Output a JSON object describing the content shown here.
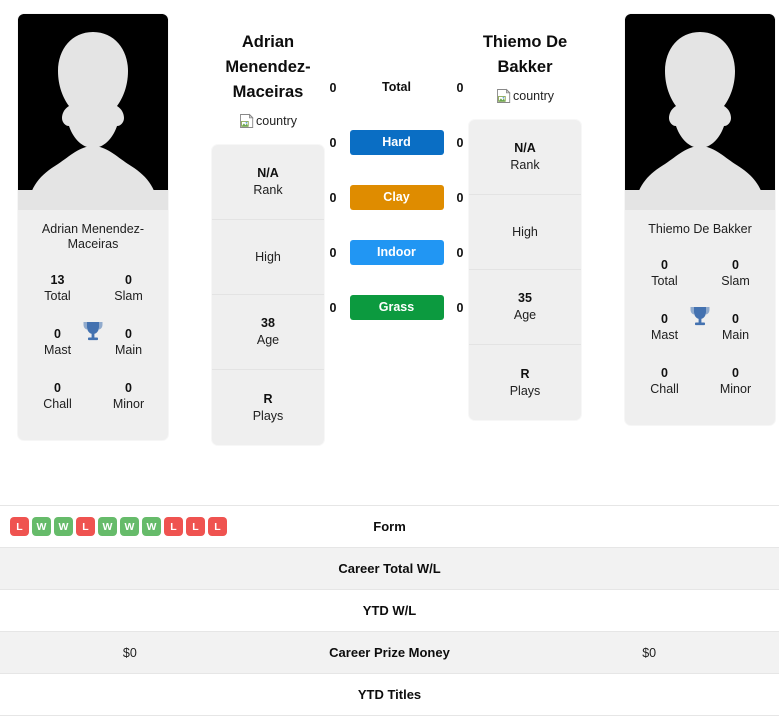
{
  "players": {
    "left": {
      "full_name": "Adrian Menendez-Maceiras",
      "card_name": "Adrian Menendez-Maceiras",
      "country_alt": "country",
      "titles": [
        {
          "value": "13",
          "label": "Total"
        },
        {
          "value": "0",
          "label": "Slam"
        },
        {
          "value": "0",
          "label": "Mast"
        },
        {
          "value": "0",
          "label": "Main"
        },
        {
          "value": "0",
          "label": "Chall"
        },
        {
          "value": "0",
          "label": "Minor"
        }
      ],
      "info": [
        {
          "value": "N/A",
          "label": "Rank"
        },
        {
          "value": "",
          "label": "High"
        },
        {
          "value": "38",
          "label": "Age"
        },
        {
          "value": "R",
          "label": "Plays"
        }
      ],
      "surface_counts": [
        "0",
        "0",
        "0",
        "0",
        "0"
      ],
      "form": [
        "L",
        "W",
        "W",
        "L",
        "W",
        "W",
        "W",
        "L",
        "L",
        "L"
      ],
      "career_total_wl": "",
      "ytd_wl": "",
      "career_prize_money": "$0",
      "ytd_titles": ""
    },
    "right": {
      "full_name": "Thiemo De Bakker",
      "card_name": "Thiemo De Bakker",
      "country_alt": "country",
      "titles": [
        {
          "value": "0",
          "label": "Total"
        },
        {
          "value": "0",
          "label": "Slam"
        },
        {
          "value": "0",
          "label": "Mast"
        },
        {
          "value": "0",
          "label": "Main"
        },
        {
          "value": "0",
          "label": "Chall"
        },
        {
          "value": "0",
          "label": "Minor"
        }
      ],
      "info": [
        {
          "value": "N/A",
          "label": "Rank"
        },
        {
          "value": "",
          "label": "High"
        },
        {
          "value": "35",
          "label": "Age"
        },
        {
          "value": "R",
          "label": "Plays"
        }
      ],
      "surface_counts": [
        "0",
        "0",
        "0",
        "0",
        "0"
      ],
      "form": [],
      "career_total_wl": "",
      "ytd_wl": "",
      "career_prize_money": "$0",
      "ytd_titles": ""
    }
  },
  "surfaces": [
    {
      "label": "Total",
      "color": "transparent",
      "text_color": "#101010"
    },
    {
      "label": "Hard",
      "color": "#0a6ec4",
      "text_color": "#ffffff"
    },
    {
      "label": "Clay",
      "color": "#df8c00",
      "text_color": "#ffffff"
    },
    {
      "label": "Indoor",
      "color": "#2196f3",
      "text_color": "#ffffff"
    },
    {
      "label": "Grass",
      "color": "#0c9a3f",
      "text_color": "#ffffff"
    }
  ],
  "table_rows": [
    {
      "label": "Form",
      "left": "",
      "right": ""
    },
    {
      "label": "Career Total W/L",
      "left": "",
      "right": ""
    },
    {
      "label": "YTD W/L",
      "left": "",
      "right": ""
    },
    {
      "label": "Career Prize Money",
      "left": "$0",
      "right": "$0"
    },
    {
      "label": "YTD Titles",
      "left": "",
      "right": ""
    }
  ],
  "colors": {
    "win_badge": "#66bb6a",
    "loss_badge": "#ef5350",
    "card_bg": "#efefef",
    "row_shade": "#f2f2f2",
    "trophy": "#4472b0"
  }
}
